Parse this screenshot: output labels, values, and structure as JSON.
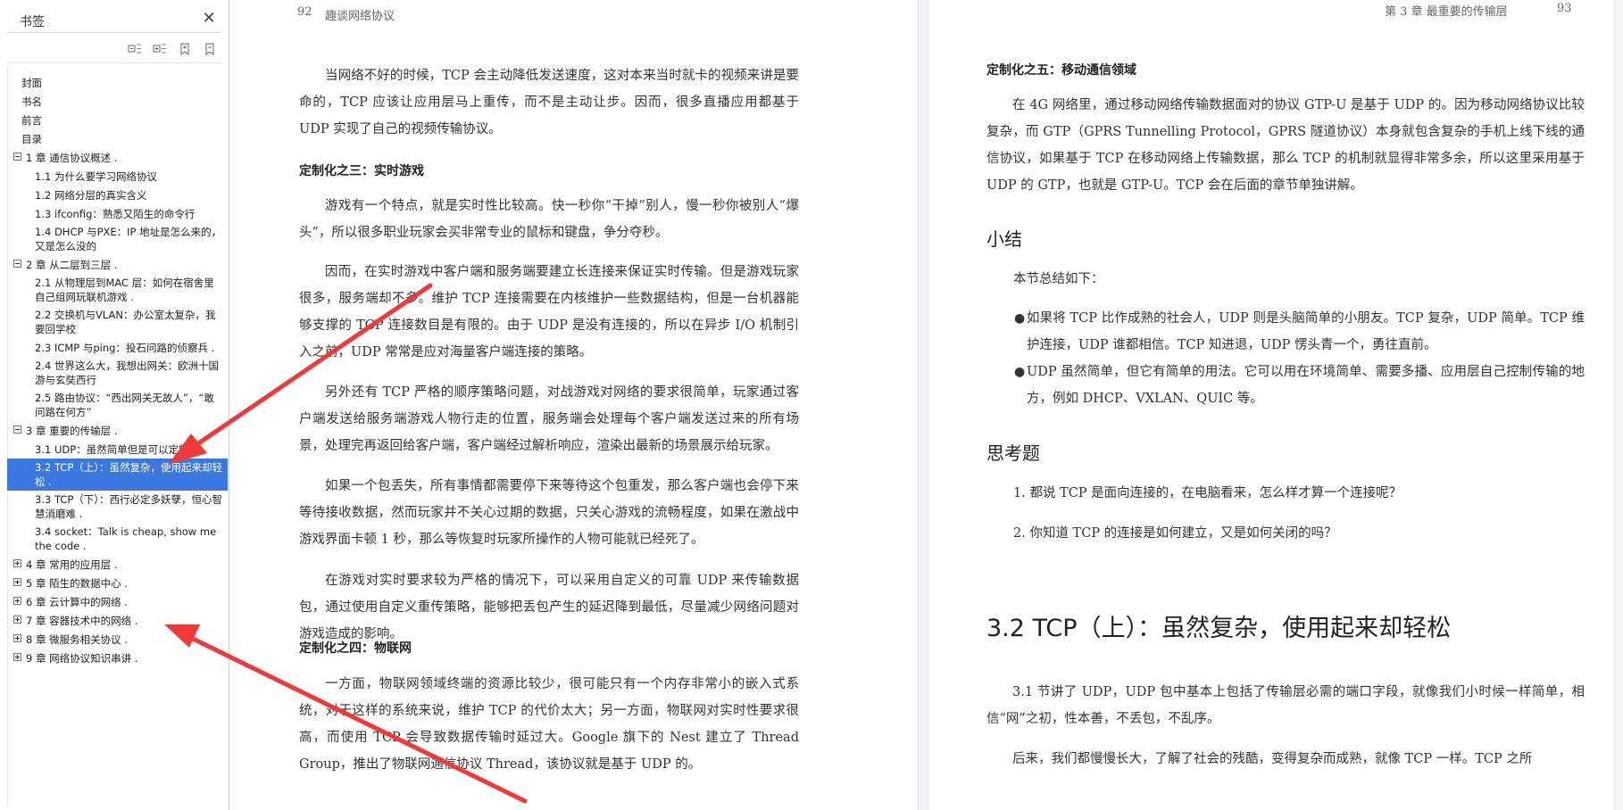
{
  "sidebar": {
    "title": "书签",
    "close_icon": "close-icon",
    "tools": [
      "collapse-all-icon",
      "expand-all-icon",
      "add-bookmark-icon",
      "bookmark-icon"
    ],
    "items": [
      {
        "label": "封面",
        "level": 0
      },
      {
        "label": "书名",
        "level": 0
      },
      {
        "label": "前言",
        "level": 0
      },
      {
        "label": "目录",
        "level": 0
      },
      {
        "label": "1 章  通信协议概述 .",
        "level": 0,
        "expander": "minus"
      },
      {
        "label": "1.1 为什么要学习网络协议",
        "level": 1
      },
      {
        "label": "1.2 网络分层的真实含义",
        "level": 1
      },
      {
        "label": "1.3 ifconfig：熟悉又陌生的命令行",
        "level": 1
      },
      {
        "label": "1.4 DHCP 与PXE：IP 地址是怎么来的，又是怎么没的",
        "level": 1,
        "lines": 2
      },
      {
        "label": "2 章  从二层到三层 .",
        "level": 0,
        "expander": "minus"
      },
      {
        "label": "2.1 从物理层到MAC 层：如何在宿舍里自己组网玩联机游戏 .",
        "level": 1,
        "lines": 2
      },
      {
        "label": "2.2 交换机与VLAN：办公室太复杂，我要回学校",
        "level": 1,
        "lines": 2
      },
      {
        "label": "2.3 ICMP 与ping：投石问路的侦察兵 .",
        "level": 1
      },
      {
        "label": "2.4 世界这么大，我想出网关：欧洲十国游与玄奘西行",
        "level": 1,
        "lines": 2
      },
      {
        "label": "2.5 路由协议：“西出网关无故人”，“敢问路在何方”",
        "level": 1,
        "lines": 2
      },
      {
        "label": "3 章  重要的传输层 .",
        "level": 0,
        "expander": "minus"
      },
      {
        "label": "3.1 UDP：虽然简单但是可以定制化",
        "level": 1
      },
      {
        "label": "3.2 TCP（上）：虽然复杂，使用起来却轻松 .",
        "level": 1,
        "lines": 2,
        "selected": true
      },
      {
        "label": "3.3 TCP（下）：西行必定多妖孽，恒心智慧消磨难 .",
        "level": 1,
        "lines": 2
      },
      {
        "label": "3.4 socket：Talk is cheap, show me the code .",
        "level": 1,
        "lines": 2
      },
      {
        "label": "4 章  常用的应用层 .",
        "level": 0,
        "expander": "plus"
      },
      {
        "label": "5 章  陌生的数据中心 .",
        "level": 0,
        "expander": "plus"
      },
      {
        "label": "6 章  云计算中的网络 .",
        "level": 0,
        "expander": "plus"
      },
      {
        "label": "7 章  容器技术中的网络 .",
        "level": 0,
        "expander": "plus"
      },
      {
        "label": "8 章  微服务相关协议 .",
        "level": 0,
        "expander": "plus"
      },
      {
        "label": "9 章  网络协议知识串讲 .",
        "level": 0,
        "expander": "plus"
      }
    ]
  },
  "left_page": {
    "page_number": "92",
    "running_head": "趣谈网络协议",
    "p1": "当网络不好的时候，TCP 会主动降低发送速度，这对本来当时就卡的视频来讲是要命的，TCP 应该让应用层马上重传，而不是主动让步。因而，很多直播应用都基于 UDP 实现了自己的视频传输协议。",
    "h3": "定制化之三：实时游戏",
    "p2": "游戏有一个特点，就是实时性比较高。快一秒你“干掉”别人，慢一秒你被别人“爆头”，所以很多职业玩家会买非常专业的鼠标和键盘，争分夺秒。",
    "p3": "因而，在实时游戏中客户端和服务端要建立长连接来保证实时传输。但是游戏玩家很多，服务端却不多。维护 TCP 连接需要在内核维护一些数据结构，但是一台机器能够支撑的 TCP 连接数目是有限的。由于 UDP 是没有连接的，所以在异步 I/O 机制引入之前，UDP 常常是应对海量客户端连接的策略。",
    "p4": "另外还有 TCP 严格的顺序策略问题，对战游戏对网络的要求很简单，玩家通过客户端发送给服务端游戏人物行走的位置，服务端会处理每个客户端发送过来的所有场景，处理完再返回给客户端，客户端经过解析响应，渲染出最新的场景展示给玩家。",
    "p5": "如果一个包丢失，所有事情都需要停下来等待这个包重发，那么客户端也会停下来等待接收数据，然而玩家并不关心过期的数据，只关心游戏的流畅程度，如果在激战中游戏界面卡顿 1 秒，那么等恢复时玩家所操作的人物可能就已经死了。",
    "p6": "在游戏对实时要求较为严格的情况下，可以采用自定义的可靠 UDP 来传输数据包，通过使用自定义重传策略，能够把丢包产生的延迟降到最低，尽量减少网络问题对游戏造成的影响。",
    "h4": "定制化之四：物联网",
    "p7": "一方面，物联网领域终端的资源比较少，很可能只有一个内存非常小的嵌入式系统，对于这样的系统来说，维护 TCP 的代价太大；另一方面，物联网对实时性要求很高，而使用 TCP 会导致数据传输时延过大。Google 旗下的 Nest 建立了 Thread Group，推出了物联网通信协议 Thread，该协议就是基于 UDP 的。"
  },
  "right_page": {
    "running_head": "第 3 章   最重要的传输层",
    "page_number": "93",
    "h5": "定制化之五：移动通信领域",
    "p1": "在 4G 网络里，通过移动网络传输数据面对的协议 GTP-U 是基于 UDP 的。因为移动网络协议比较复杂，而 GTP（GPRS Tunnelling Protocol，GPRS 隧道协议）本身就包含复杂的手机上线下线的通信协议，如果基于 TCP 在移动网络上传输数据，那么 TCP 的机制就显得非常多余，所以这里采用基于 UDP 的 GTP，也就是 GTP-U。TCP 会在后面的章节单独讲解。",
    "summary_heading": "小结",
    "summary_intro": "本节总结如下：",
    "bullets": [
      "如果将 TCP 比作成熟的社会人，UDP 则是头脑简单的小朋友。TCP 复杂，UDP 简单。TCP 维护连接，UDP 谁都相信。TCP 知进退，UDP 愣头青一个，勇往直前。",
      "UDP 虽然简单，但它有简单的用法。它可以用在环境简单、需要多播、应用层自己控制传输的地方，例如 DHCP、VXLAN、QUIC 等。"
    ],
    "bullet_symbol": "●",
    "questions_heading": "思考题",
    "questions": [
      "1.  都说 TCP 是面向连接的，在电脑看来，怎么样才算一个连接呢？",
      "2.  你知道 TCP 的连接是如何建立，又是如何关闭的吗？"
    ],
    "section_heading": "3.2   TCP（上）：虽然复杂，使用起来却轻松",
    "p2": "3.1 节讲了 UDP，UDP 包中基本上包括了传输层必需的端口字段，就像我们小时候一样简单，相信“网”之初，性本善，不丢包，不乱序。",
    "p3": "后来，我们都慢慢长大，了解了社会的残酷，变得复杂而成熟，就像 TCP 一样。TCP 之所"
  },
  "colors": {
    "selection": "#3a78e0",
    "arrow": "#f03a3a"
  }
}
